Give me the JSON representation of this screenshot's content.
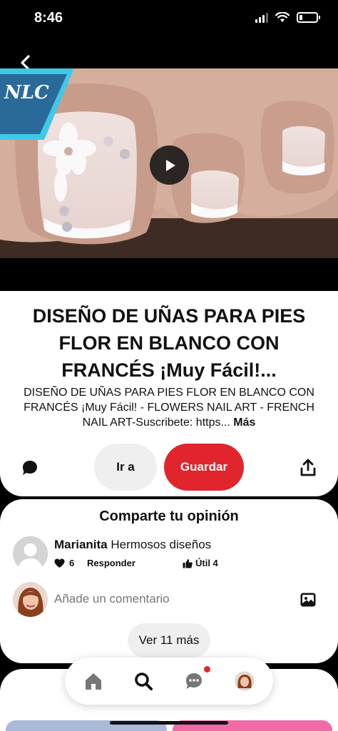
{
  "status_bar": {
    "time": "8:46",
    "battery_level": 0.2,
    "icons": [
      "signal-icon",
      "wifi-icon",
      "battery-icon"
    ]
  },
  "media": {
    "back_icon": "chevron-left-icon",
    "play_icon": "play-icon",
    "watermark_text": "NLC"
  },
  "pin": {
    "title": "DISEÑO DE UÑAS PARA PIES FLOR EN BLANCO CON FRANCÉS ¡Muy Fácil!...",
    "description": "DISEÑO DE UÑAS PARA PIES FLOR EN BLANCO CON FRANCÉS ¡Muy Fácil! - FLOWERS NAIL ART - FRENCH NAIL ART-Suscribete: https...",
    "more_label": "Más"
  },
  "actions": {
    "comment_icon": "comment-bubble-icon",
    "visit_label": "Ir a",
    "save_label": "Guardar",
    "share_icon": "share-icon",
    "save_color": "#e1252c"
  },
  "comments": {
    "heading": "Comparte tu opinión",
    "items": [
      {
        "author": "Marianita",
        "text": "Hermosos diseños",
        "likes": "6",
        "reply_label": "Responder",
        "useful_label": "Útil 4"
      }
    ],
    "add_placeholder": "Añade un comentario",
    "see_more_label": "Ver 11 más"
  },
  "bottom_nav": {
    "items": [
      "home-icon",
      "search-icon",
      "messages-icon",
      "profile-avatar"
    ],
    "notification_color": "#e1252c"
  }
}
